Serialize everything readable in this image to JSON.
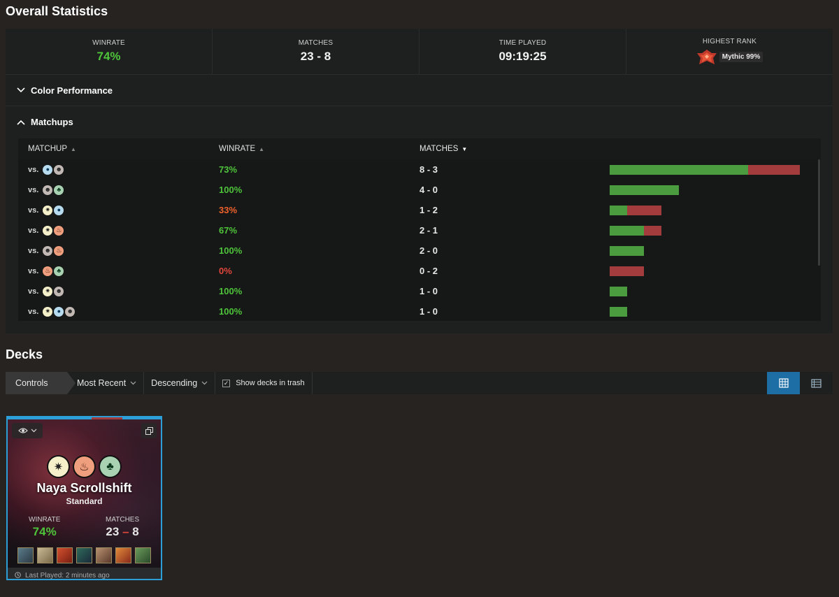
{
  "overall": {
    "title": "Overall Statistics",
    "stats": {
      "winrate_label": "WINRATE",
      "winrate_value": "74%",
      "matches_label": "MATCHES",
      "matches_value": "23 - 8",
      "time_label": "TIME PLAYED",
      "time_value": "09:19:25",
      "rank_label": "HIGHEST RANK",
      "rank_value": "Mythic 99%"
    },
    "color_performance": {
      "label": "Color Performance",
      "expanded": false
    },
    "matchups": {
      "label": "Matchups",
      "expanded": true,
      "columns": {
        "matchup": "MATCHUP",
        "winrate": "WINRATE",
        "matches": "MATCHES"
      },
      "sort_column": "matches",
      "rows": [
        {
          "vs": "vs.",
          "colors": [
            "U",
            "B"
          ],
          "winrate": "73%",
          "matches": "8 - 3",
          "wins": 8,
          "losses": 3
        },
        {
          "vs": "vs.",
          "colors": [
            "B",
            "G"
          ],
          "winrate": "100%",
          "matches": "4 - 0",
          "wins": 4,
          "losses": 0
        },
        {
          "vs": "vs.",
          "colors": [
            "W",
            "U"
          ],
          "winrate": "33%",
          "matches": "1 - 2",
          "wins": 1,
          "losses": 2
        },
        {
          "vs": "vs.",
          "colors": [
            "W",
            "R"
          ],
          "winrate": "67%",
          "matches": "2 - 1",
          "wins": 2,
          "losses": 1
        },
        {
          "vs": "vs.",
          "colors": [
            "B",
            "R"
          ],
          "winrate": "100%",
          "matches": "2 - 0",
          "wins": 2,
          "losses": 0
        },
        {
          "vs": "vs.",
          "colors": [
            "R",
            "G"
          ],
          "winrate": "0%",
          "matches": "0 - 2",
          "wins": 0,
          "losses": 2
        },
        {
          "vs": "vs.",
          "colors": [
            "W",
            "B"
          ],
          "winrate": "100%",
          "matches": "1 - 0",
          "wins": 1,
          "losses": 0
        },
        {
          "vs": "vs.",
          "colors": [
            "W",
            "U",
            "B"
          ],
          "winrate": "100%",
          "matches": "1 - 0",
          "wins": 1,
          "losses": 0
        }
      ]
    }
  },
  "decks": {
    "title": "Decks",
    "toolbar": {
      "controls_label": "Controls",
      "sort_label": "Most Recent",
      "order_label": "Descending",
      "show_trash_label": "Show decks in trash",
      "show_trash_checked": true,
      "view_mode": "grid"
    },
    "cards": [
      {
        "name": "Naya Scrollshift",
        "format": "Standard",
        "colors": [
          "W",
          "R",
          "G"
        ],
        "winrate_label": "WINRATE",
        "winrate_value": "74%",
        "matches_label": "MATCHES",
        "matches_wins": "23",
        "matches_sep": "–",
        "matches_losses": "8",
        "last_played": "Last Played: 2 minutes ago"
      }
    ]
  },
  "colors": {
    "win_green": "#4ec43a",
    "loss_red": "#e2473b",
    "mid_orange": "#f0622c",
    "accent_blue": "#1c6ea4"
  }
}
